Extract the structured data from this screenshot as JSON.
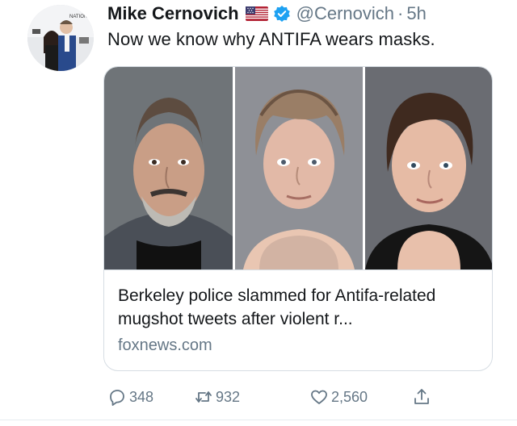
{
  "tweet": {
    "author_name": "Mike Cernovich",
    "handle": "@Cernovich",
    "separator": "·",
    "time": "5h",
    "text": "Now we know why ANTIFA wears masks.",
    "flag_icon": "us-flag-icon",
    "verified_icon": "verified-badge-icon"
  },
  "card": {
    "title": "Berkeley police slammed for Antifa-related mugshot tweets after violent r...",
    "domain": "foxnews.com",
    "photos": [
      "mugshot-man",
      "mugshot-woman-older",
      "mugshot-woman-short-hair"
    ]
  },
  "actions": {
    "replies": "348",
    "retweets": "932",
    "likes": "2,560",
    "icons": [
      "reply-icon",
      "retweet-icon",
      "like-icon",
      "share-icon"
    ]
  },
  "colors": {
    "text": "#14171a",
    "muted": "#657786",
    "border": "#d6dde3",
    "verified": "#1da1f2"
  }
}
